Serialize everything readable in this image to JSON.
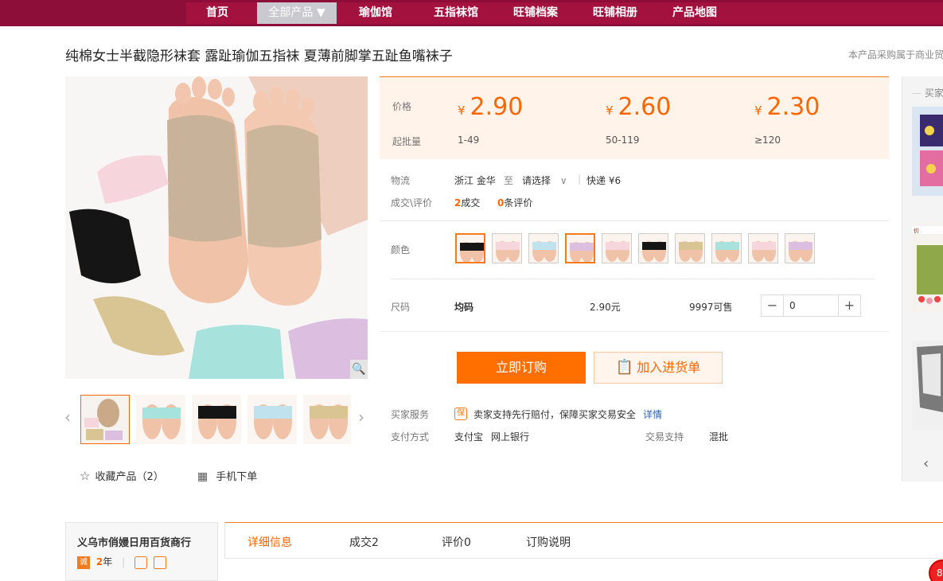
{
  "nav": {
    "items": [
      "首页",
      "全部产品 ▼",
      "瑜伽馆",
      "五指袜馆",
      "旺铺档案",
      "旺铺相册",
      "产品地图"
    ]
  },
  "product": {
    "title": "纯棉女士半截隐形袜套 露趾瑜伽五指袜 夏薄前脚掌五趾鱼嘴袜子",
    "notice": "本产品采购属于商业贸"
  },
  "price_box": {
    "price_label": "价格",
    "qty_label": "起批量",
    "currency": "¥",
    "tiers": [
      {
        "price": "2.90",
        "qty": "1-49"
      },
      {
        "price": "2.60",
        "qty": "50-119"
      },
      {
        "price": "2.30",
        "qty": "≥120"
      }
    ]
  },
  "logistics": {
    "label": "物流",
    "origin": "浙江 金华",
    "to": "至",
    "dest": "请选择",
    "express": "快递 ¥6"
  },
  "deals": {
    "label": "成交\\评价",
    "deal_count": "2",
    "deal_text": "成交",
    "review_count": "0",
    "review_text": "条评价"
  },
  "color": {
    "label": "颜色",
    "swatch_count": 10
  },
  "size": {
    "label": "尺码",
    "value": "均码",
    "price": "2.90元",
    "stock": "9997可售",
    "quantity": "0"
  },
  "actions": {
    "buy": "立即订购",
    "cart": "加入进货单"
  },
  "service": {
    "label": "买家服务",
    "badge": "保",
    "text": "卖家支持先行赔付，保障买家交易安全",
    "link": "详情"
  },
  "payment": {
    "label": "支付方式",
    "methods": [
      "支付宝",
      "网上银行"
    ],
    "trade_label": "交易支持",
    "trade_value": "混批"
  },
  "left": {
    "fav": "收藏产品（2）",
    "mobile": "手机下单"
  },
  "side": {
    "title": "买家"
  },
  "shop": {
    "name": "义乌市俏嫚日用百货商行",
    "badge": "诚",
    "years_num": "2",
    "years_unit": "年"
  },
  "tabs": [
    "详细信息",
    "成交2",
    "评价0",
    "订购说明"
  ],
  "help": {
    "text": "8"
  },
  "colors": {
    "brand": "#8e0e3a",
    "accent": "#ff6600",
    "price_bg": "#fff3ea"
  }
}
